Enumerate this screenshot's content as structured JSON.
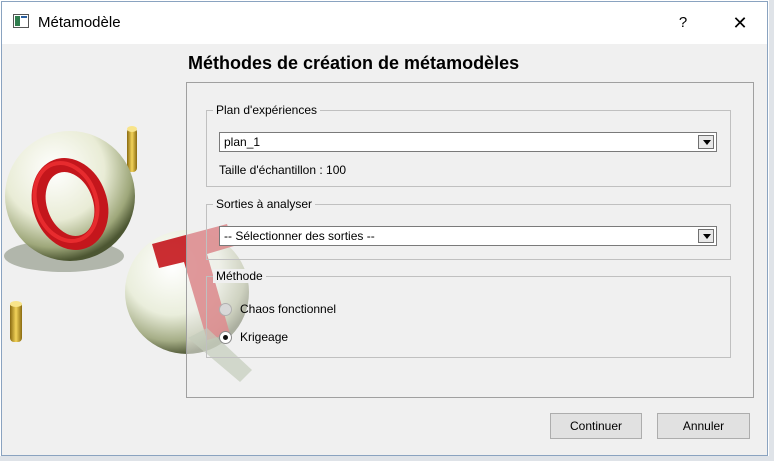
{
  "window": {
    "title": "Métamodèle",
    "help_label": "?",
    "close_label": "✕"
  },
  "main": {
    "title": "Méthodes de création de métamodèles"
  },
  "plan_group": {
    "legend": "Plan d'expériences",
    "selected": "plan_1",
    "sample_size_label": "Taille d'échantillon : 100"
  },
  "outputs_group": {
    "legend": "Sorties à analyser",
    "selected": "-- Sélectionner des sorties --"
  },
  "method_group": {
    "legend": "Méthode",
    "options": [
      {
        "label": "Chaos fonctionnel",
        "checked": false,
        "enabled": false
      },
      {
        "label": "Krigeage",
        "checked": true,
        "enabled": true
      }
    ]
  },
  "buttons": {
    "continue": "Continuer",
    "cancel": "Annuler"
  },
  "icons": {
    "app": "window-icon",
    "combo_arrow": "chevron-down-icon"
  },
  "colors": {
    "dialog_bg": "#f0f0f0",
    "logo_red": "#c4161c",
    "logo_gold": "#c9a227"
  }
}
